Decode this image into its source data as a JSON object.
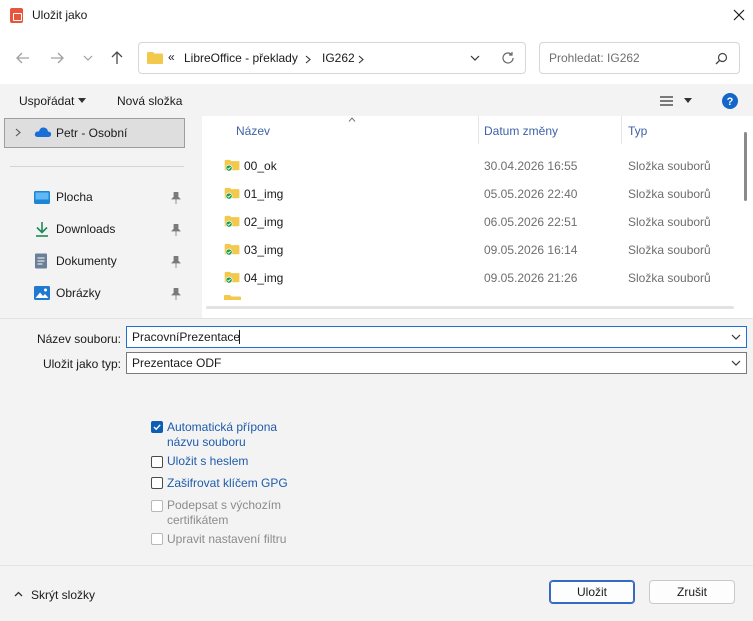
{
  "window": {
    "title": "Uložit jako",
    "close_icon": "×"
  },
  "nav": {
    "breadcrumb_chevron": "«",
    "breadcrumb": [
      "LibreOffice - překlady",
      "IG262"
    ],
    "search_placeholder": "Prohledat: IG262"
  },
  "toolbar": {
    "organize_label": "Uspořádat",
    "new_folder_label": "Nová složka"
  },
  "sidebar": {
    "root_item": "Petr - Osobní",
    "items": [
      {
        "label": "Plocha",
        "icon": "desktop-icon"
      },
      {
        "label": "Downloads",
        "icon": "download-icon"
      },
      {
        "label": "Dokumenty",
        "icon": "documents-icon"
      },
      {
        "label": "Obrázky",
        "icon": "pictures-icon"
      }
    ]
  },
  "filelist": {
    "columns": [
      "Název",
      "Datum změny",
      "Typ"
    ],
    "rows": [
      {
        "name": "00_ok",
        "date": "30.04.2026 16:55",
        "type": "Složka souborů"
      },
      {
        "name": "01_img",
        "date": "05.05.2026 22:40",
        "type": "Složka souborů"
      },
      {
        "name": "02_img",
        "date": "06.05.2026 22:51",
        "type": "Složka souborů"
      },
      {
        "name": "03_img",
        "date": "09.05.2026 16:14",
        "type": "Složka souborů"
      },
      {
        "name": "04_img",
        "date": "09.05.2026 21:26",
        "type": "Složka souborů"
      }
    ]
  },
  "form": {
    "filename_label": "Název souboru:",
    "filename_value": "PracovníPrezentace",
    "filetype_label": "Uložit jako typ:",
    "filetype_value": "Prezentace ODF"
  },
  "options": [
    {
      "label": "Automatická přípona\nnázvu souboru",
      "checked": true,
      "enabled": true
    },
    {
      "label": "Uložit s heslem",
      "checked": false,
      "enabled": true
    },
    {
      "label": "Zašifrovat klíčem GPG",
      "checked": false,
      "enabled": true
    },
    {
      "label": "Podepsat s výchozím\ncertifikátem",
      "checked": false,
      "enabled": false
    },
    {
      "label": "Upravit nastavení filtru",
      "checked": false,
      "enabled": false
    }
  ],
  "footer": {
    "hide_folders_label": "Skrýt složky",
    "save_label": "Uložit",
    "cancel_label": "Zrušit"
  },
  "colors": {
    "accent": "#0a5fb4",
    "folder": "#f2c94c"
  }
}
